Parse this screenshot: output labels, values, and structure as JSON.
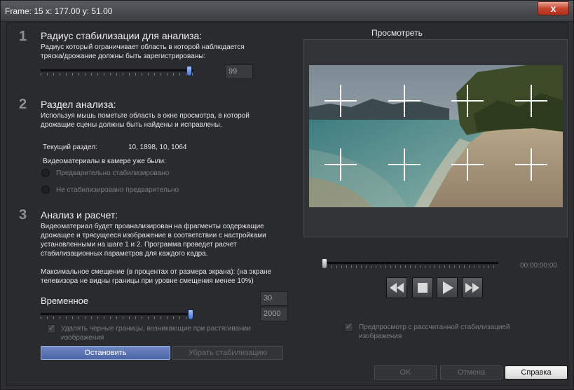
{
  "window": {
    "title": "Frame:  15   x: 177.00    y: 51.00",
    "close_glyph": "x"
  },
  "section1": {
    "number": "1",
    "title": "Радиус стабилизации для анализа:",
    "description_line1": "Радиус который ограничивает область в которой наблюдается",
    "description_line2": "тряска/дрожание должны быть зарегистрированы:",
    "radius_value": "99",
    "radius_slider_fraction": 0.99
  },
  "section2": {
    "number": "2",
    "title": "Раздел анализа:",
    "description_line1": "Используя мышь пометьте область в окне просмотра, в которой",
    "description_line2": "дрожащие сцены должны быть найдены и исправлены.",
    "current_section_label": "Текущий раздел:",
    "current_section_value": "10, 1898, 10, 1064",
    "camera_label": "Видеоматериалы в камере уже были:",
    "radio_prestabilized": "Предварительно стабилизировано",
    "radio_not_prestabilized": "Не стабилизировано предварительно"
  },
  "section3": {
    "number": "3",
    "title": "Анализ и расчет:",
    "description_line1": "Видеоматериал будет проанализирован на фрагменты содержащие",
    "description_line2": "дрожащее и трясущееся изображение в соответствии с настройками",
    "description_line3": "установленными на шаге 1 и 2. Программа проведет расчет",
    "description_line4": "стабилизационных параметров для каждого кадра.",
    "max_offset_line1": "Максимальное смещение (в процентах от размера экрана): (на экране",
    "max_offset_line2": "телевизора не видны границы при уровне смещения менее 10%)",
    "offset_value": "30",
    "temporal_label": "Временное",
    "temporal_value": "2000",
    "temporal_slider_fraction": 1.0,
    "remove_borders_line1": "Удалять черные границы, возникающие при растягивании",
    "remove_borders_line2": "изображения",
    "stop_button": "Остановить",
    "remove_stab_button": "Убрать стабилизацию"
  },
  "preview": {
    "label": "Просмотреть",
    "timecode": "00:00:00:00",
    "seek_fraction": 0.0,
    "preview_checkbox_line1": "Предпросмотр с рассчитанной стабилизацией",
    "preview_checkbox_line2": "изображения",
    "grid_rows": 2,
    "grid_cols": 4
  },
  "footer": {
    "ok": "OK",
    "cancel": "Отмена",
    "help": "Справка"
  },
  "colors": {
    "accent": "#4b65a6",
    "thumb": "#3e6fd8",
    "close": "#c6452f"
  }
}
